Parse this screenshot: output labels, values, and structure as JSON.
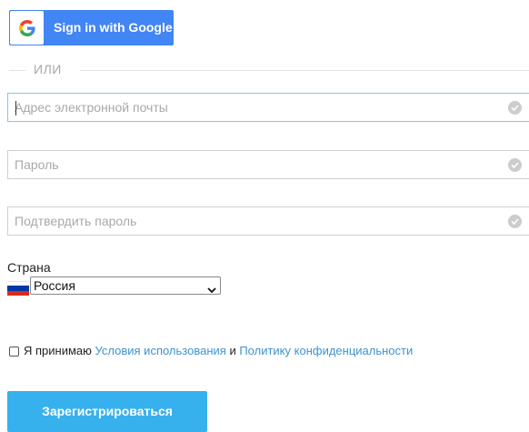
{
  "google_button": {
    "label": "Sign in with Google",
    "icon": "google-g-icon"
  },
  "divider": {
    "text": "ИЛИ"
  },
  "fields": {
    "email": {
      "placeholder": "Адрес электронной почты",
      "value": ""
    },
    "password": {
      "placeholder": "Пароль",
      "value": ""
    },
    "confirm_password": {
      "placeholder": "Подтвердить пароль",
      "value": ""
    }
  },
  "country": {
    "label": "Страна",
    "selected": "Россия",
    "flag_colors": [
      "#ffffff",
      "#0039a6",
      "#d52b1e"
    ]
  },
  "terms": {
    "prefix": "Я принимаю",
    "terms_link": "Условия использования",
    "conjunction": "и",
    "privacy_link": "Политику конфиденциальности"
  },
  "submit": {
    "label": "Зарегистрироваться"
  },
  "colors": {
    "google_blue": "#4285f4",
    "submit_blue": "#36b1ee",
    "link_blue": "#3d93d1",
    "focus_border": "#7fc7f0"
  }
}
